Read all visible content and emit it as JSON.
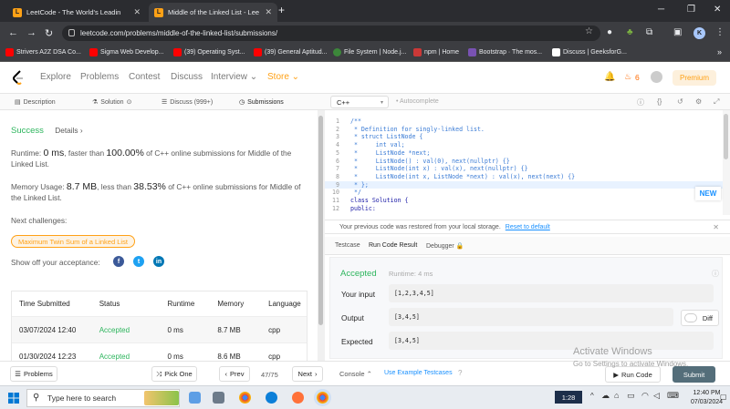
{
  "browser": {
    "tabs": [
      {
        "title": "LeetCode - The World's Leadin"
      },
      {
        "title": "Middle of the Linked List - Lee"
      }
    ],
    "new_tab": "+",
    "url": "leetcode.com/problems/middle-of-the-linked-list/submissions/",
    "profile_initial": "K",
    "bookmarks": [
      {
        "label": "Strivers A2Z DSA Co...",
        "color": "#ff0000"
      },
      {
        "label": "Sigma Web Develop...",
        "color": "#ff0000"
      },
      {
        "label": "(39) Operating Syst...",
        "color": "#ff0000"
      },
      {
        "label": "(39) General Aptitud...",
        "color": "#ff0000"
      },
      {
        "label": "File System | Node.j...",
        "color": "#3c873a"
      },
      {
        "label": "npm | Home",
        "color": "#cb3837"
      },
      {
        "label": "Bootstrap · The mos...",
        "color": "#7952b3"
      },
      {
        "label": "Discuss | GeeksforG...",
        "color": "#ffffff"
      }
    ],
    "more_bookmarks": "»"
  },
  "leetcode_nav": {
    "items": [
      "Explore",
      "Problems",
      "Contest",
      "Discuss",
      "Interview ⌄",
      "Store ⌄"
    ],
    "streak": "6",
    "premium": "Premium"
  },
  "left_tabs": {
    "description": "Description",
    "solution": "Solution",
    "discuss": "Discuss (999+)",
    "submissions": "Submissions"
  },
  "result": {
    "status": "Success",
    "details": "Details",
    "runtime_prefix": "Runtime: ",
    "runtime_value": "0 ms",
    "runtime_mid": ", faster than ",
    "runtime_pct": "100.00%",
    "runtime_suffix": " of C++ online submissions for Middle of the Linked List.",
    "memory_prefix": "Memory Usage: ",
    "memory_value": "8.7 MB",
    "memory_mid": ", less than ",
    "memory_pct": "38.53%",
    "memory_suffix": " of C++ online submissions for Middle of the Linked List.",
    "next_challenges": "Next challenges:",
    "challenge": "Maximum Twin Sum of a Linked List",
    "share": "Show off your acceptance:"
  },
  "submissions_table": {
    "headers": [
      "Time Submitted",
      "Status",
      "Runtime",
      "Memory",
      "Language"
    ],
    "rows": [
      [
        "03/07/2024 12:40",
        "Accepted",
        "0 ms",
        "8.7 MB",
        "cpp"
      ],
      [
        "01/30/2024 12:23",
        "Accepted",
        "0 ms",
        "8.6 MB",
        "cpp"
      ]
    ]
  },
  "bottom_left": {
    "problems": "Problems",
    "pick_one": "Pick One",
    "prev": "Prev",
    "page": "47/75",
    "next": "Next"
  },
  "editor": {
    "language": "C++",
    "autocomplete": "Autocomplete",
    "lines": [
      {
        "n": "1",
        "text": "/**"
      },
      {
        "n": "2",
        "text": " * Definition for singly-linked list."
      },
      {
        "n": "3",
        "text": " * struct ListNode {"
      },
      {
        "n": "4",
        "text": " *     int val;"
      },
      {
        "n": "5",
        "text": " *     ListNode *next;"
      },
      {
        "n": "6",
        "text": " *     ListNode() : val(0), next(nullptr) {}"
      },
      {
        "n": "7",
        "text": " *     ListNode(int x) : val(x), next(nullptr) {}"
      },
      {
        "n": "8",
        "text": " *     ListNode(int x, ListNode *next) : val(x), next(next) {}"
      },
      {
        "n": "9",
        "text": " * };"
      },
      {
        "n": "10",
        "text": " */"
      },
      {
        "n": "11",
        "text": "class Solution {"
      },
      {
        "n": "12",
        "text": "public:"
      }
    ],
    "new_badge": "NEW",
    "restored_msg": "Your previous code was restored from your local storage.",
    "reset_link": "Reset to default"
  },
  "console_tabs": {
    "testcase": "Testcase",
    "run_result": "Run Code Result",
    "debugger": "Debugger"
  },
  "run_result": {
    "status": "Accepted",
    "runtime": "Runtime: 4 ms",
    "input_label": "Your input",
    "input_value": "[1,2,3,4,5]",
    "output_label": "Output",
    "output_value": "[3,4,5]",
    "expected_label": "Expected",
    "expected_value": "[3,4,5]",
    "diff": "Diff"
  },
  "bottom_right": {
    "console": "Console",
    "use_example": "Use Example Testcases",
    "run_code": "Run Code",
    "submit": "Submit"
  },
  "watermark": {
    "line1": "Activate Windows",
    "line2": "Go to Settings to activate Windows."
  },
  "taskbar": {
    "search_placeholder": "Type here to search",
    "badge": "1:28",
    "time": "12:40 PM",
    "date": "07/03/2024"
  }
}
